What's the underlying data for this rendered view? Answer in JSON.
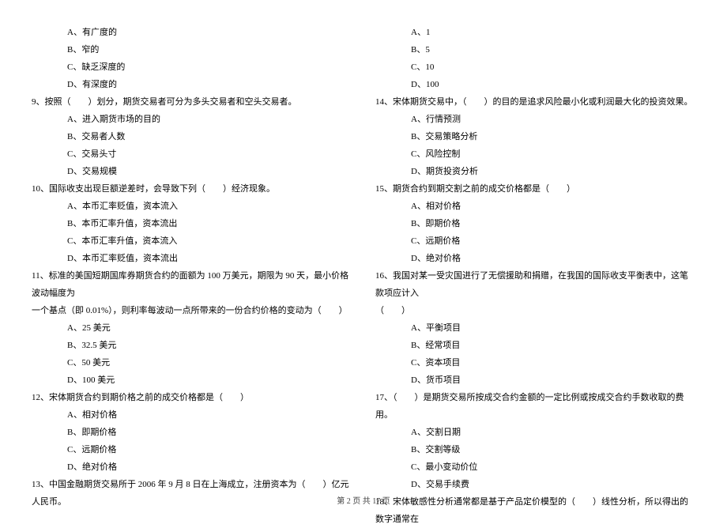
{
  "left_col": {
    "q8_opts": {
      "a": "A、有广度的",
      "b": "B、窄的",
      "c": "C、缺乏深度的",
      "d": "D、有深度的"
    },
    "q9": {
      "text": "9、按照（　　）划分，期货交易者可分为多头交易者和空头交易者。",
      "a": "A、进入期货市场的目的",
      "b": "B、交易者人数",
      "c": "C、交易头寸",
      "d": "D、交易规模"
    },
    "q10": {
      "text": "10、国际收支出现巨额逆差时，会导致下列（　　）经济现象。",
      "a": "A、本币汇率贬值，资本流入",
      "b": "B、本币汇率升值，资本流出",
      "c": "C、本币汇率升值，资本流入",
      "d": "D、本币汇率贬值，资本流出"
    },
    "q11": {
      "text": "11、标准的美国短期国库券期货合约的面额为 100 万美元，期限为 90 天，最小价格波动幅度为",
      "text2": "一个基点（即 0.01%），则利率每波动一点所带来的一份合约价格的变动为（　　）",
      "a": "A、25 美元",
      "b": "B、32.5 美元",
      "c": "C、50 美元",
      "d": "D、100 美元"
    },
    "q12": {
      "text": "12、宋体期货合约到期价格之前的成交价格都是（　　）",
      "a": "A、相对价格",
      "b": "B、即期价格",
      "c": "C、远期价格",
      "d": "D、绝对价格"
    },
    "q13": {
      "text": "13、中国金融期货交易所于 2006 年 9 月 8 日在上海成立，注册资本为（　　）亿元人民币。"
    }
  },
  "right_col": {
    "q13_opts": {
      "a": "A、1",
      "b": "B、5",
      "c": "C、10",
      "d": "D、100"
    },
    "q14": {
      "text": "14、宋体期货交易中，（　　）的目的是追求风险最小化或利润最大化的投资效果。",
      "a": "A、行情预测",
      "b": "B、交易策略分析",
      "c": "C、风险控制",
      "d": "D、期货投资分析"
    },
    "q15": {
      "text": "15、期货合约到期交割之前的成交价格都是（　　）",
      "a": "A、相对价格",
      "b": "B、即期价格",
      "c": "C、远期价格",
      "d": "D、绝对价格"
    },
    "q16": {
      "text": "16、我国对某一受灾国进行了无偿援助和捐赠，在我国的国际收支平衡表中，这笔款项应计入",
      "text2": "（　　）",
      "a": "A、平衡项目",
      "b": "B、经常项目",
      "c": "C、资本项目",
      "d": "D、货币项目"
    },
    "q17": {
      "text": "17、（　　）是期货交易所按成交合约金额的一定比例或按成交合约手数收取的费用。",
      "a": "A、交割日期",
      "b": "B、交割等级",
      "c": "C、最小变动价位",
      "d": "D、交易手续费"
    },
    "q18": {
      "text": "18、宋体敏感性分析通常都是基于产品定价模型的（　　）线性分析，所以得出的数字通常在"
    }
  },
  "footer": "第 2 页 共 17 页"
}
